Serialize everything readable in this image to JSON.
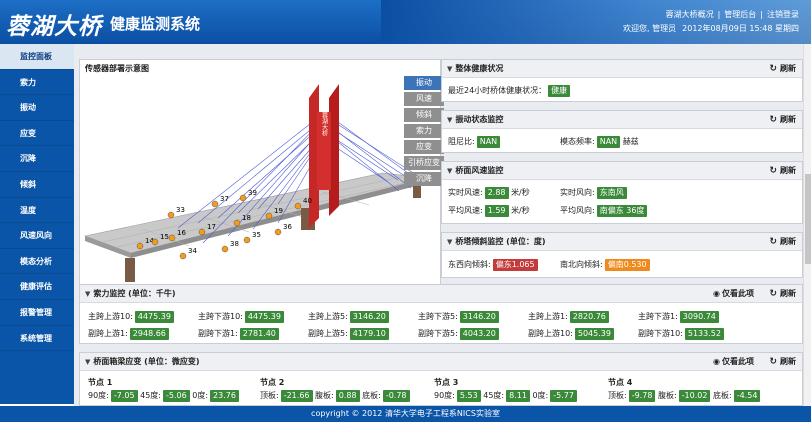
{
  "header": {
    "logo": "蓉湖大桥",
    "system_title": "健康监测系统",
    "links": [
      "蓉湖大桥概况",
      "管理后台",
      "注销登录"
    ],
    "welcome": "欢迎您, 管理员",
    "datetime": "2012年08月09日 15:48 星期四"
  },
  "sidebar": {
    "items": [
      "监控面板",
      "索力",
      "振动",
      "应变",
      "沉降",
      "倾斜",
      "温度",
      "风速风向",
      "模态分析",
      "健康评估",
      "报警管理",
      "系统管理"
    ],
    "active_index": 0
  },
  "sensor_panel": {
    "title": "传感器部署示意图",
    "tower_text": "蓉湖大桥",
    "tabs": [
      "振动",
      "风速",
      "倾斜",
      "索力",
      "应变",
      "引桥应变",
      "沉降"
    ],
    "active_tab": 0,
    "markers": [
      "14",
      "15",
      "16",
      "17",
      "18",
      "19",
      "33",
      "34",
      "35",
      "36",
      "37",
      "38",
      "39",
      "40"
    ]
  },
  "health": {
    "title": "整体健康状况",
    "label": "最近24小时桥体健康状况：",
    "status": "健康"
  },
  "vibration": {
    "title": "振动状态监控",
    "damping_label": "阻尼比:",
    "damping_value": "NAN",
    "modal_label": "模态频率:",
    "modal_value": "NAN",
    "modal_unit": "赫兹"
  },
  "wind": {
    "title": "桥面风速监控",
    "rt_speed_label": "实时风速:",
    "rt_speed": "2.88",
    "rt_speed_unit": "米/秒",
    "rt_dir_label": "实时风向:",
    "rt_dir": "东南风",
    "avg_speed_label": "平均风速:",
    "avg_speed": "1.59",
    "avg_speed_unit": "米/秒",
    "avg_dir_label": "平均风向:",
    "avg_dir": "南偏东 36度"
  },
  "tilt": {
    "title": "桥塔倾斜监控 (单位：度)",
    "ew_label": "东西向倾斜:",
    "ew_value": "偏东1.065",
    "ns_label": "南北向倾斜:",
    "ns_value": "偏南0.530"
  },
  "cable": {
    "title": "索力监控 (单位：千牛)",
    "row1": [
      {
        "label": "主跨上游10:",
        "value": "4475.39"
      },
      {
        "label": "主跨下游10:",
        "value": "4475.39"
      },
      {
        "label": "主跨上游5:",
        "value": "3146.20"
      },
      {
        "label": "主跨下游5:",
        "value": "3146.20"
      },
      {
        "label": "主跨上游1:",
        "value": "2820.76"
      },
      {
        "label": "主跨下游1:",
        "value": "3090.74"
      }
    ],
    "row2": [
      {
        "label": "副跨上游1:",
        "value": "2948.66"
      },
      {
        "label": "副跨下游1:",
        "value": "2781.40"
      },
      {
        "label": "副跨上游5:",
        "value": "4179.10"
      },
      {
        "label": "副跨下游5:",
        "value": "4043.20"
      },
      {
        "label": "副跨上游10:",
        "value": "5045.39"
      },
      {
        "label": "副跨下游10:",
        "value": "5133.52"
      }
    ]
  },
  "strain": {
    "title": "桥面箱梁应变 (单位：微应变)",
    "nodes": [
      {
        "name": "节点 1",
        "items": [
          {
            "label": "90度:",
            "value": "-7.05"
          },
          {
            "label": "45度:",
            "value": "-5.06"
          },
          {
            "label": "0度:",
            "value": "23.76"
          }
        ]
      },
      {
        "name": "节点 2",
        "items": [
          {
            "label": "顶板:",
            "value": "-21.66"
          },
          {
            "label": "腹板:",
            "value": "0.88"
          },
          {
            "label": "底板:",
            "value": "-0.78"
          }
        ]
      },
      {
        "name": "节点 3",
        "items": [
          {
            "label": "90度:",
            "value": "5.53"
          },
          {
            "label": "45度:",
            "value": "8.11"
          },
          {
            "label": "0度:",
            "value": "-5.77"
          }
        ]
      },
      {
        "name": "节点 4",
        "items": [
          {
            "label": "顶板:",
            "value": "-9.78"
          },
          {
            "label": "腹板:",
            "value": "-10.02"
          },
          {
            "label": "底板:",
            "value": "-4.54"
          }
        ]
      }
    ]
  },
  "common": {
    "refresh": "刷新",
    "only_this": "仅看此项"
  },
  "footer": "copyright © 2012 清华大学电子工程系NICS实验室",
  "colors": {
    "header": "#0b4fa3",
    "sidebar": "#0b55a8",
    "ok": "#3a8a3a",
    "alert": "#c43b3b",
    "warn": "#f08a1d"
  }
}
